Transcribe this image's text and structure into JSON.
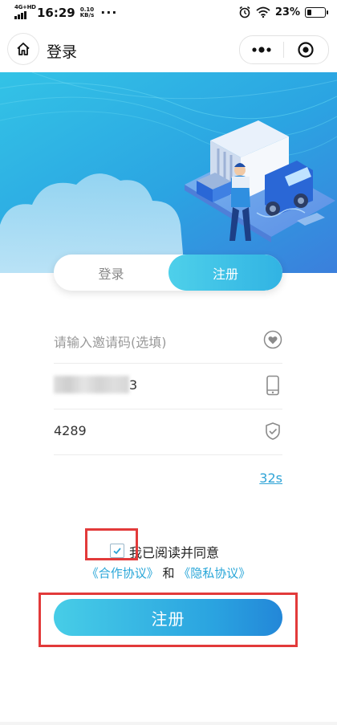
{
  "status_bar": {
    "network": "4G+HD",
    "time": "16:29",
    "speed_value": "0.10",
    "speed_unit": "KB/s",
    "more": "···",
    "battery_percent": "23%",
    "battery_level": 0.23
  },
  "nav": {
    "title": "登录"
  },
  "tabs": {
    "login_label": "登录",
    "register_label": "注册",
    "active": "register"
  },
  "form": {
    "invite_placeholder": "请输入邀请码(选填)",
    "phone_visible_suffix": "3",
    "code_value": "4289",
    "countdown": "32s"
  },
  "agreement": {
    "checked": true,
    "text": "我已阅读并同意",
    "cooperation_link": "《合作协议》",
    "and_text": "和",
    "privacy_link": "《隐私协议》"
  },
  "submit": {
    "label": "注册"
  },
  "colors": {
    "accent": "#31b3e3",
    "link": "#28a6d8",
    "highlight_box": "#e23a3a"
  },
  "icons": {
    "nav": [
      "home-icon",
      "more-icon",
      "target-icon"
    ],
    "fields": [
      "heart-icon",
      "phone-icon",
      "shield-check-icon"
    ],
    "status": [
      "signal-icon",
      "alarm-icon",
      "wifi-icon",
      "battery-icon"
    ]
  }
}
